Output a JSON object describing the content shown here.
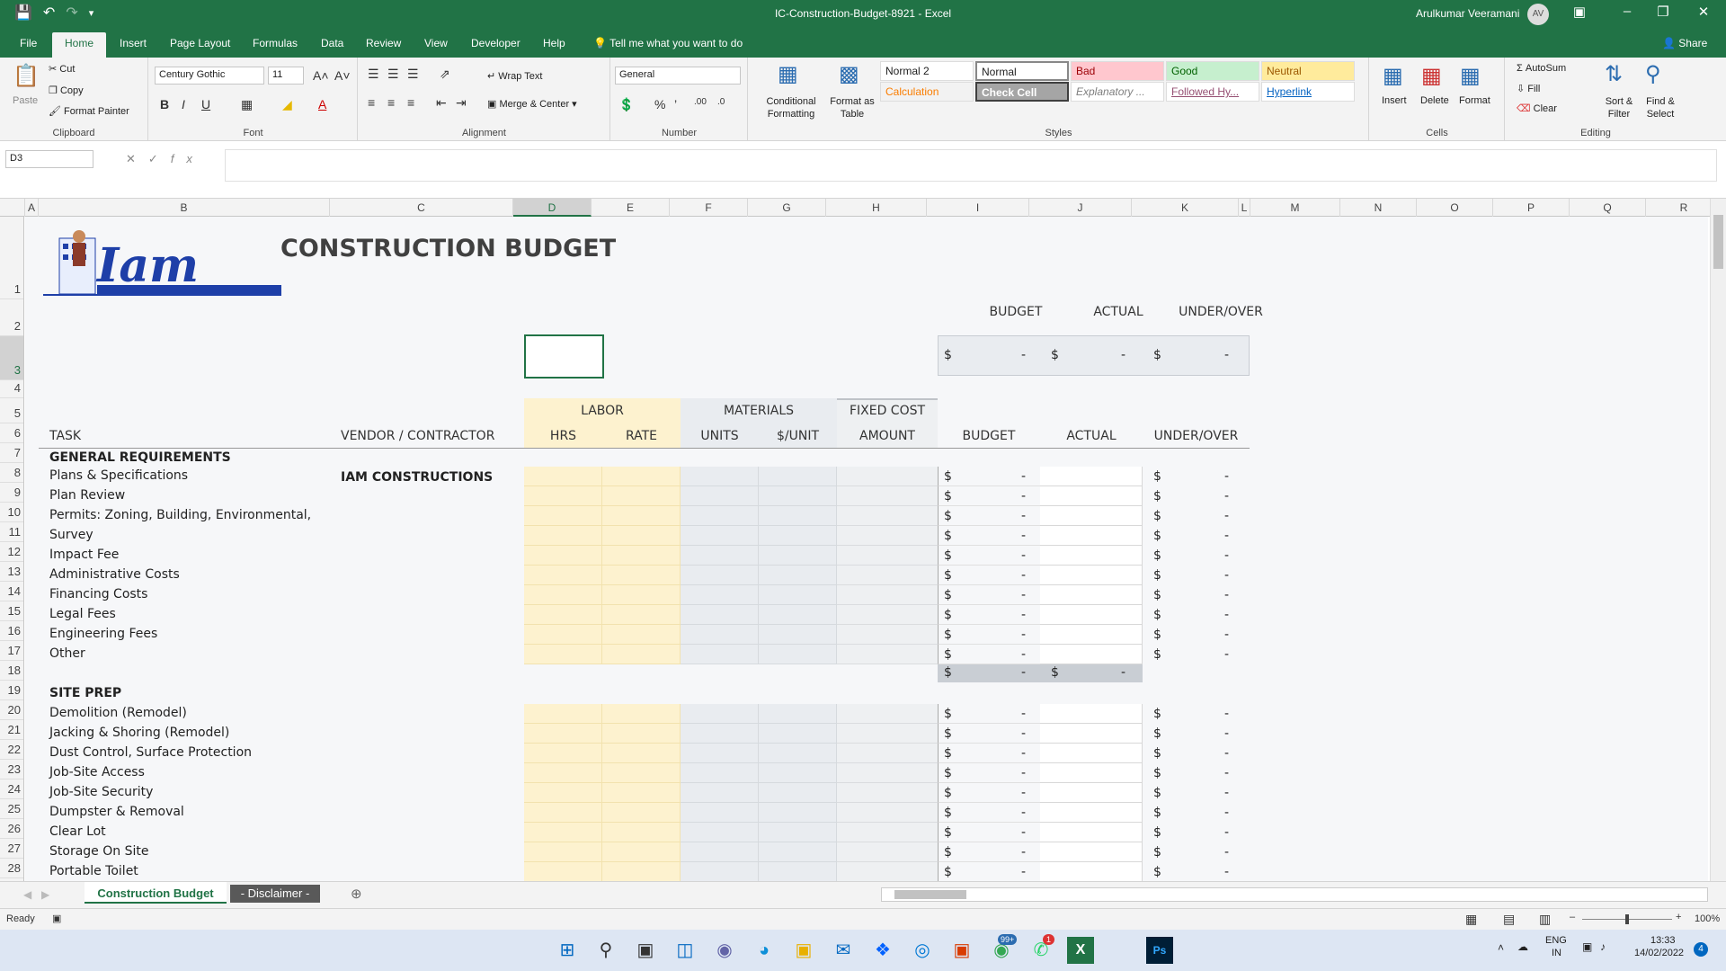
{
  "window": {
    "title": "IC-Construction-Budget-8921  -  Excel",
    "user": "Arulkumar Veeramani",
    "user_initials": "AV"
  },
  "tabs": [
    "File",
    "Home",
    "Insert",
    "Page Layout",
    "Formulas",
    "Data",
    "Review",
    "View",
    "Developer",
    "Help"
  ],
  "active_tab": "Home",
  "tell_me": "Tell me what you want to do",
  "share": "Share",
  "ribbon": {
    "clipboard": {
      "paste": "Paste",
      "cut": "Cut",
      "copy": "Copy",
      "format_painter": "Format Painter",
      "label": "Clipboard"
    },
    "font": {
      "name": "Century Gothic",
      "size": "11",
      "label": "Font"
    },
    "alignment": {
      "wrap": "Wrap Text",
      "merge": "Merge & Center",
      "label": "Alignment"
    },
    "number": {
      "format": "General",
      "label": "Number"
    },
    "styles": {
      "conditional": "Conditional Formatting",
      "format_table": "Format as Table",
      "cells": [
        {
          "name": "Normal 2",
          "bg": "#ffffff",
          "fg": "#222222"
        },
        {
          "name": "Normal",
          "bg": "#ffffff",
          "fg": "#222222"
        },
        {
          "name": "Bad",
          "bg": "#ffc7ce",
          "fg": "#9c0006"
        },
        {
          "name": "Good",
          "bg": "#c6efce",
          "fg": "#006100"
        },
        {
          "name": "Neutral",
          "bg": "#ffeb9c",
          "fg": "#9c5700"
        },
        {
          "name": "Calculation",
          "bg": "#f2f2f2",
          "fg": "#fa7d00"
        },
        {
          "name": "Check Cell",
          "bg": "#a5a5a5",
          "fg": "#ffffff"
        },
        {
          "name": "Explanatory ...",
          "bg": "#ffffff",
          "fg": "#7f7f7f"
        },
        {
          "name": "Followed Hy...",
          "bg": "#ffffff",
          "fg": "#954f72"
        },
        {
          "name": "Hyperlink",
          "bg": "#ffffff",
          "fg": "#0563c1"
        }
      ],
      "label": "Styles"
    },
    "cells": {
      "insert": "Insert",
      "delete": "Delete",
      "format": "Format",
      "label": "Cells"
    },
    "editing": {
      "autosum": "AutoSum",
      "fill": "Fill",
      "clear": "Clear",
      "sort": "Sort & Filter",
      "find": "Find & Select",
      "label": "Editing"
    }
  },
  "name_box": "D3",
  "columns": [
    "A",
    "B",
    "C",
    "D",
    "E",
    "F",
    "G",
    "H",
    "I",
    "J",
    "K",
    "L",
    "M",
    "N",
    "O",
    "P",
    "Q",
    "R"
  ],
  "sheet": {
    "title": "CONSTRUCTION BUDGET",
    "summary_headers": [
      "BUDGET",
      "ACTUAL",
      "UNDER/OVER"
    ],
    "dollar": "$",
    "dash": "-",
    "group_headers": {
      "labor": "LABOR",
      "materials": "MATERIALS",
      "fixed": "FIXED COST"
    },
    "col_headers": {
      "task": "TASK",
      "vendor": "VENDOR / CONTRACTOR",
      "hrs": "HRS",
      "rate": "RATE",
      "units": "UNITS",
      "per_unit": "$/UNIT",
      "amount": "AMOUNT",
      "budget": "BUDGET",
      "actual": "ACTUAL",
      "under_over": "UNDER/OVER"
    },
    "section1": "GENERAL REQUIREMENTS",
    "vendor1": "IAM CONSTRUCTIONS",
    "tasks1": [
      "Plans & Specifications",
      "Plan Review",
      "Permits: Zoning, Building, Environmental,",
      "Survey",
      "Impact Fee",
      "Administrative Costs",
      "Financing Costs",
      "Legal Fees",
      "Engineering Fees",
      "Other"
    ],
    "section2": "SITE PREP",
    "tasks2": [
      "Demolition (Remodel)",
      "Jacking & Shoring (Remodel)",
      "Dust Control, Surface Protection",
      "Job-Site Access",
      "Job-Site Security",
      "Dumpster & Removal",
      "Clear Lot",
      "Storage On Site",
      "Portable Toilet"
    ]
  },
  "rows": [
    "1",
    "2",
    "3",
    "4",
    "5",
    "6",
    "7",
    "8",
    "9",
    "10",
    "11",
    "12",
    "13",
    "14",
    "15",
    "16",
    "17",
    "18",
    "19",
    "20",
    "21",
    "22",
    "23",
    "24",
    "25",
    "26",
    "27",
    "28"
  ],
  "sheet_tabs": [
    "Construction Budget",
    "- Disclaimer -"
  ],
  "status": {
    "ready": "Ready",
    "zoom": "100%"
  },
  "taskbar": {
    "lang": "ENG",
    "region": "IN",
    "time": "13:33",
    "date": "14/02/2022",
    "badge_chrome": "99+",
    "badge_whatsapp": "1",
    "badge_notif": "4"
  }
}
